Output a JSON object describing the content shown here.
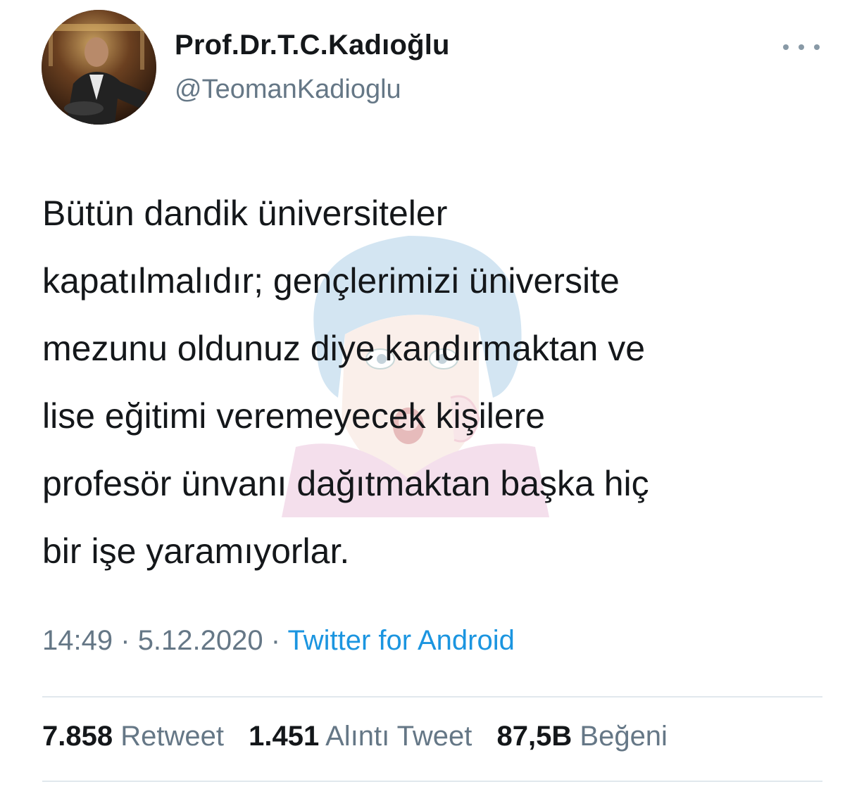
{
  "author": {
    "display_name": "Prof.Dr.T.C.Kadıoğlu",
    "handle": "@TeomanKadioglu",
    "avatar_icon": "profile-photo"
  },
  "more_icon": "ellipsis-icon",
  "tweet": {
    "text": "Bütün dandik üniversiteler\nkapatılmalıdır; gençlerimizi üniversite\nmezunu oldunuz diye kandırmaktan ve\nlise eğitimi veremeyecek kişilere\nprofesör ünvanı dağıtmaktan başka hiç\nbir işe yaramıyorlar."
  },
  "meta": {
    "time": "14:49",
    "separator": "·",
    "date": "5.12.2020",
    "source": "Twitter for Android"
  },
  "stats": {
    "retweets": {
      "count": "7.858",
      "label": "Retweet"
    },
    "quotes": {
      "count": "1.451",
      "label": "Alıntı Tweet"
    },
    "likes": {
      "count": "87,5B",
      "label": "Beğeni"
    }
  },
  "colors": {
    "text": "#14171a",
    "secondary": "#657786",
    "link": "#1b95e0",
    "divider": "#e1e8ed"
  }
}
